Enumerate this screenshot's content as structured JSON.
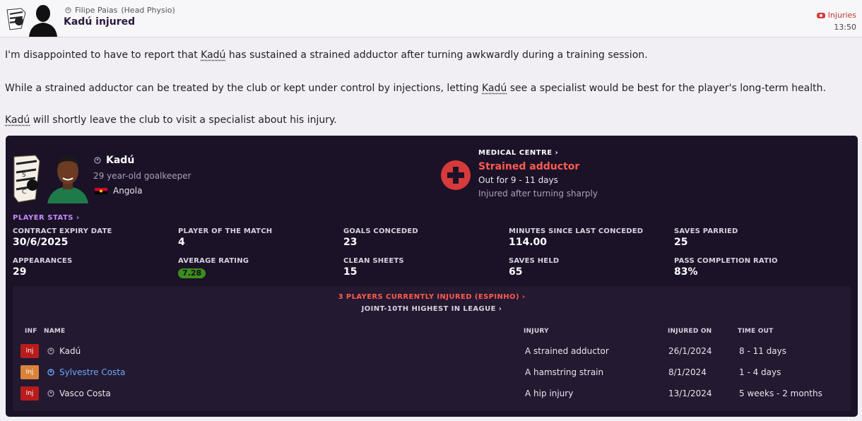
{
  "header": {
    "sender_name": "Filipe Paias",
    "sender_role": "(Head Physio)",
    "title": "Kadú injured",
    "tag": "Injuries",
    "time": "13:50"
  },
  "body": {
    "p1_before": "I'm disappointed to have to report that ",
    "p1_link": "Kadú",
    "p1_after": " has sustained a strained adductor after turning awkwardly during a training session.",
    "p2_before": "While a strained adductor can be treated by the club or kept under control by injections, letting ",
    "p2_link": "Kadú",
    "p2_after": " see a specialist would be best for the player's long-term health.",
    "p3_link": "Kadú",
    "p3_after": " will shortly leave the club to visit a specialist about his injury."
  },
  "player": {
    "name": "Kadú",
    "description": "29 year-old goalkeeper",
    "nationality": "Angola"
  },
  "medical": {
    "label": "MEDICAL CENTRE",
    "injury": "Strained adductor",
    "out_for": "Out for 9 - 11 days",
    "cause": "Injured after turning sharply"
  },
  "stats": {
    "section_title": "PLAYER STATS",
    "items": [
      {
        "label": "CONTRACT EXPIRY DATE",
        "value": "30/6/2025"
      },
      {
        "label": "PLAYER OF THE MATCH",
        "value": "4"
      },
      {
        "label": "GOALS CONCEDED",
        "value": "23"
      },
      {
        "label": "MINUTES SINCE LAST CONCEDED",
        "value": "114.00"
      },
      {
        "label": "SAVES PARRIED",
        "value": "25"
      },
      {
        "label": "APPEARANCES",
        "value": "29"
      },
      {
        "label": "AVERAGE RATING",
        "value": "7.28"
      },
      {
        "label": "CLEAN SHEETS",
        "value": "15"
      },
      {
        "label": "SAVES HELD",
        "value": "65"
      },
      {
        "label": "PASS COMPLETION RATIO",
        "value": "83%"
      }
    ]
  },
  "injuries": {
    "count_title": "3 PLAYERS CURRENTLY INJURED (ESPINHO)",
    "rank_title": "JOINT-10TH HIGHEST IN LEAGUE",
    "columns": [
      "INF",
      "NAME",
      "INJURY",
      "INJURED ON",
      "TIME OUT"
    ],
    "rows": [
      {
        "badge": "Inj",
        "name": "Kadú",
        "injury": "A strained adductor",
        "date": "26/1/2024",
        "time_out": "8 - 11 days"
      },
      {
        "badge": "Inj",
        "name": "Sylvestre Costa",
        "injury": "A hamstring strain",
        "date": "8/1/2024",
        "time_out": "1 - 4 days"
      },
      {
        "badge": "Inj",
        "name": "Vasco Costa",
        "injury": "A hip injury",
        "date": "13/1/2024",
        "time_out": "5 weeks - 2 months"
      }
    ]
  },
  "colors": {
    "card_bg": "#1b1227",
    "injury_red": "#ff5a4f",
    "stats_purple": "#c48cff",
    "rating_green": "#3c8d1e",
    "badge_red": "#b81c1c",
    "badge_orange": "#d9833a",
    "link_blue": "#6aa8ff"
  }
}
